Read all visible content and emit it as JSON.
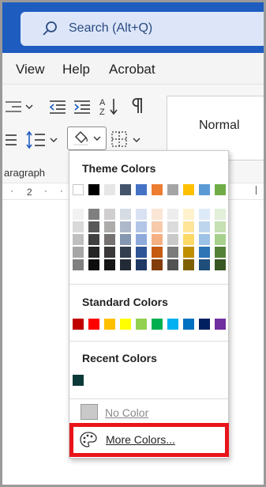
{
  "search": {
    "placeholder_text": "Search (Alt+Q)",
    "icon": "search-icon"
  },
  "menu": {
    "items": [
      "View",
      "Help",
      "Acrobat"
    ]
  },
  "ribbon": {
    "style_normal": "Normal",
    "group_label": "aragraph",
    "ruler_label": "2"
  },
  "dropdown": {
    "theme_title": "Theme Colors",
    "standard_title": "Standard Colors",
    "recent_title": "Recent Colors",
    "no_color_label": "No Color",
    "more_colors_label": "More Colors...",
    "theme_colors": [
      "#ffffff",
      "#000000",
      "#e7e6e6",
      "#44546a",
      "#4472c4",
      "#ed7d31",
      "#a5a5a5",
      "#ffc000",
      "#5b9bd5",
      "#70ad47"
    ],
    "shades": [
      [
        "#f2f2f2",
        "#d9d9d9",
        "#bfbfbf",
        "#a6a6a6",
        "#808080"
      ],
      [
        "#7f7f7f",
        "#595959",
        "#404040",
        "#262626",
        "#0d0d0d"
      ],
      [
        "#d0cece",
        "#aeabab",
        "#757171",
        "#3a3838",
        "#171616"
      ],
      [
        "#d6dce4",
        "#adb9ca",
        "#8496b0",
        "#333f4f",
        "#222a35"
      ],
      [
        "#d9e2f3",
        "#b4c6e7",
        "#8eaadb",
        "#2f5496",
        "#1f3864"
      ],
      [
        "#fbe5d5",
        "#f7caac",
        "#f4b083",
        "#c55a11",
        "#833c0b"
      ],
      [
        "#ededed",
        "#dbdbdb",
        "#c9c9c9",
        "#7b7b7b",
        "#525252"
      ],
      [
        "#fff2cc",
        "#fee599",
        "#ffd965",
        "#bf8f00",
        "#7f6000"
      ],
      [
        "#deeaf6",
        "#bdd6ee",
        "#9cc2e5",
        "#2e75b5",
        "#1e4e79"
      ],
      [
        "#e2efd9",
        "#c5e0b3",
        "#a8d08d",
        "#538135",
        "#375623"
      ]
    ],
    "standard_colors": [
      "#c00000",
      "#ff0000",
      "#ffc000",
      "#ffff00",
      "#92d050",
      "#00b050",
      "#00b0f0",
      "#0070c0",
      "#002060",
      "#7030a0"
    ],
    "recent_colors": [
      "#0c3a38"
    ]
  },
  "highlight_color": "#e8141a"
}
